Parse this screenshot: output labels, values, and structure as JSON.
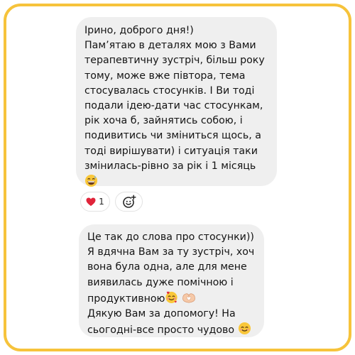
{
  "messages": [
    {
      "lines": [
        "Ірино, доброго дня!)",
        "Пам’ятаю в деталях мою з Вами",
        "терапевтичну зустріч, більш року",
        "тому, може вже півтора, тема",
        "стосувалась стосунків. І Ви тоді",
        "подали ідею-дати час стосункам,",
        "рік хоча б, зайнятись собою, і",
        "подивитись чи зміниться щось, а",
        "тоді вирішувати) і ситуація таки",
        "змінилась-рівно за рік і 1 місяць"
      ],
      "end_emoji": "grinning-sweat-emoji",
      "reaction": {
        "emoji": "red-heart-emoji",
        "count": "1"
      }
    },
    {
      "lines": [
        "Це так до слова про стосунки))",
        "Я вдячна Вам за ту зустріч, хоч",
        "вона була одна, але для мене",
        "виявилась дуже помічною і",
        "продуктивною",
        "Дякую Вам за допомогу! На",
        "сьогодні-все просто чудово"
      ],
      "inline_emojis": [
        "smiling-face-with-hearts-emoji",
        "heart-hands-emoji"
      ],
      "end_emoji": "smiling-face-emoji"
    }
  ],
  "colors": {
    "frame": "#f6c33b",
    "bubble": "#efefef",
    "text": "#141414"
  },
  "icons": {
    "add_reaction": "add-reaction-icon"
  }
}
